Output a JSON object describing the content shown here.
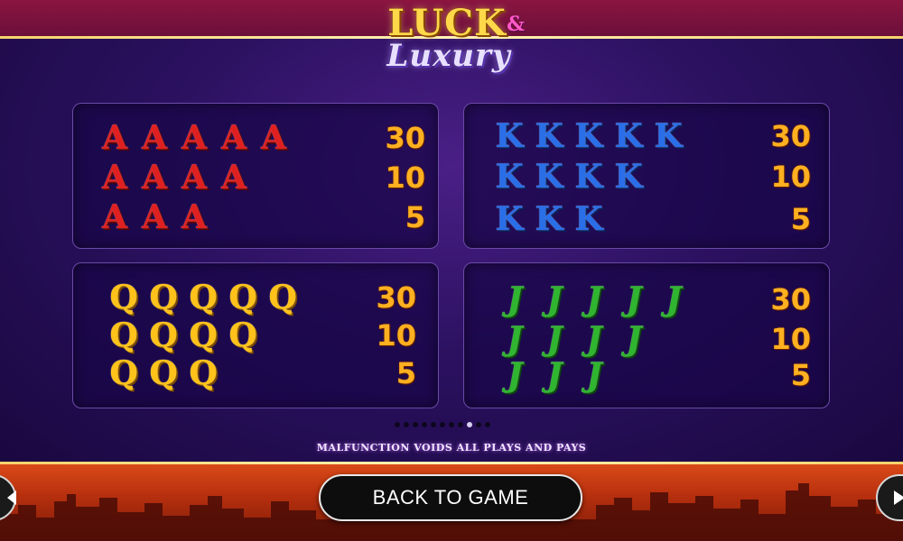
{
  "logo": {
    "word1": "LUCK",
    "ampersand": "&",
    "word2": "Luxury"
  },
  "paytable": [
    {
      "id": "a",
      "symbol": "A",
      "color": "#e02020",
      "rows": [
        {
          "count": 5,
          "pay": "30"
        },
        {
          "count": 4,
          "pay": "10"
        },
        {
          "count": 3,
          "pay": "5"
        }
      ]
    },
    {
      "id": "k",
      "symbol": "K",
      "color": "#2a6ee8",
      "rows": [
        {
          "count": 5,
          "pay": "30"
        },
        {
          "count": 4,
          "pay": "10"
        },
        {
          "count": 3,
          "pay": "5"
        }
      ]
    },
    {
      "id": "q",
      "symbol": "Q",
      "color": "#ffc21a",
      "rows": [
        {
          "count": 5,
          "pay": "30"
        },
        {
          "count": 4,
          "pay": "10"
        },
        {
          "count": 3,
          "pay": "5"
        }
      ]
    },
    {
      "id": "j",
      "symbol": "J",
      "color": "#2fb52f",
      "rows": [
        {
          "count": 5,
          "pay": "30"
        },
        {
          "count": 4,
          "pay": "10"
        },
        {
          "count": 3,
          "pay": "5"
        }
      ]
    }
  ],
  "pagination": {
    "total": 11,
    "current": 9
  },
  "disclaimer": "MALFUNCTION VOIDS ALL PLAYS AND PAYS",
  "back_button": "BACK TO GAME",
  "icons": {
    "prev": "arrow-left-icon",
    "next": "arrow-right-icon"
  },
  "colors": {
    "payout": "#ffb020",
    "frame_gold": "#f6d36b",
    "panel_border": "#6a4aa8"
  }
}
